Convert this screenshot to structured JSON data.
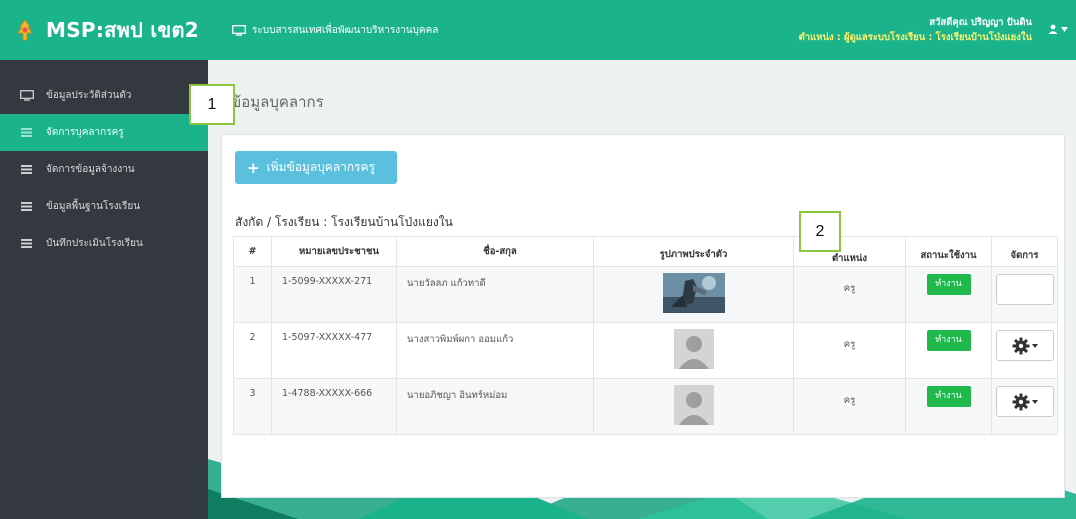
{
  "header": {
    "brand": "MSP:สพป เขต2",
    "system_title": "ระบบสารสนเทศเพื่อพัฒนาบริหารงานบุคคล",
    "user_greeting": "สวัสดีคุณ ปริญญา ปันดิน",
    "user_position": "ตำแหน่ง : ผู้ดูแลระบบโรงเรียน : โรงเรียนบ้านโป่งแยงใน"
  },
  "sidebar": {
    "items": [
      {
        "label": "ข้อมูลประวัติส่วนตัว",
        "icon": "monitor-icon"
      },
      {
        "label": "จัดการบุคลากรครู",
        "icon": "list-icon"
      },
      {
        "label": "จัดการข้อมูลจ้างงาน",
        "icon": "list-icon"
      },
      {
        "label": "ข้อมูลพื้นฐานโรงเรียน",
        "icon": "list-icon"
      },
      {
        "label": "บันทึกประเมินโรงเรียน",
        "icon": "list-icon"
      }
    ]
  },
  "main": {
    "page_title": "ข้อมูลบุคลากร",
    "add_button_label": "เพิ่มข้อมูลบุคลากรครู",
    "school_line": "สังกัด / โรงเรียน : โรงเรียนบ้านโป่งแยงใน",
    "callout_1": "1",
    "callout_2": "2"
  },
  "table": {
    "headers": [
      "#",
      "หมายเลขประชาชน",
      "ชื่อ-สกุล",
      "รูปภาพประจำตัว",
      "ตำแหน่ง",
      "สถานะใช้งาน",
      "จัดการ"
    ],
    "rows": [
      {
        "num": "1",
        "id": "1-5099-XXXXX-271",
        "name": "นายวัลลภ แก้วทาดี",
        "position": "ครู",
        "status": "ทำงาน"
      },
      {
        "num": "2",
        "id": "1-5097-XXXXX-477",
        "name": "นางสาวพิมพ์ผกา ออมแก้ว",
        "position": "ครู",
        "status": "ทำงาน"
      },
      {
        "num": "3",
        "id": "1-4788-XXXXX-666",
        "name": "นายอภิชญา อินทร์หม่อม",
        "position": "ครู",
        "status": "ทำงาน"
      }
    ]
  },
  "colors": {
    "brand_green": "#1bb38c",
    "sidebar_dark": "#33393e",
    "add_button_blue": "#5bc0de",
    "status_green": "#1fb84a",
    "position_yellow": "#fff36b",
    "callout_border": "#8cc63f"
  }
}
